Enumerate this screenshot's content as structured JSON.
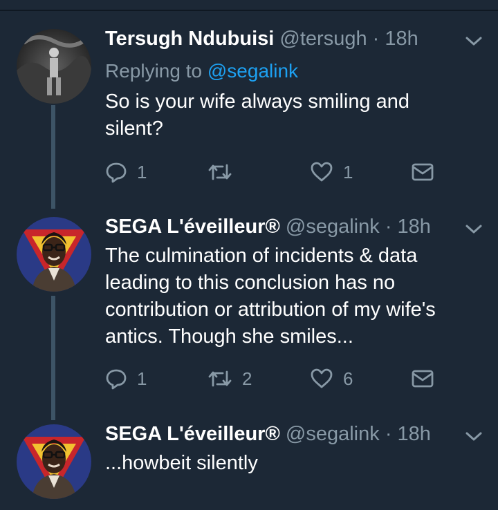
{
  "tweets": [
    {
      "name": "Tersugh Ndubuisi",
      "handle": "@tersugh",
      "separator": "·",
      "time": "18h",
      "replying_label": "Replying to",
      "replying_handle": "@segalink",
      "text": "So is your wife always smiling and silent?",
      "replies": "1",
      "retweets": "",
      "likes": "1",
      "avatar": "profile-photo-outdoor-person",
      "icons": [
        "reply-icon",
        "retweet-icon",
        "like-icon",
        "message-icon",
        "chevron-down-icon"
      ]
    },
    {
      "name": "SEGA L'éveilleur®",
      "handle": "@segalink",
      "separator": "·",
      "time": "18h",
      "text": "The culmination of incidents & data leading to this conclusion has no contribution or attribution of my wife's antics. Though she smiles...",
      "replies": "1",
      "retweets": "2",
      "likes": "6",
      "avatar": "profile-photo-man-glasses-superman-logo",
      "icons": [
        "reply-icon",
        "retweet-icon",
        "like-icon",
        "message-icon",
        "chevron-down-icon"
      ]
    },
    {
      "name": "SEGA L'éveilleur®",
      "handle": "@segalink",
      "separator": "·",
      "time": "18h",
      "text": "...howbeit silently",
      "avatar": "profile-photo-man-glasses-superman-logo",
      "icons": [
        "chevron-down-icon"
      ]
    }
  ],
  "colors": {
    "background": "#1c2836",
    "secondary_text": "#8899a6",
    "link": "#1da1f2",
    "thread_line": "#3d5466"
  }
}
